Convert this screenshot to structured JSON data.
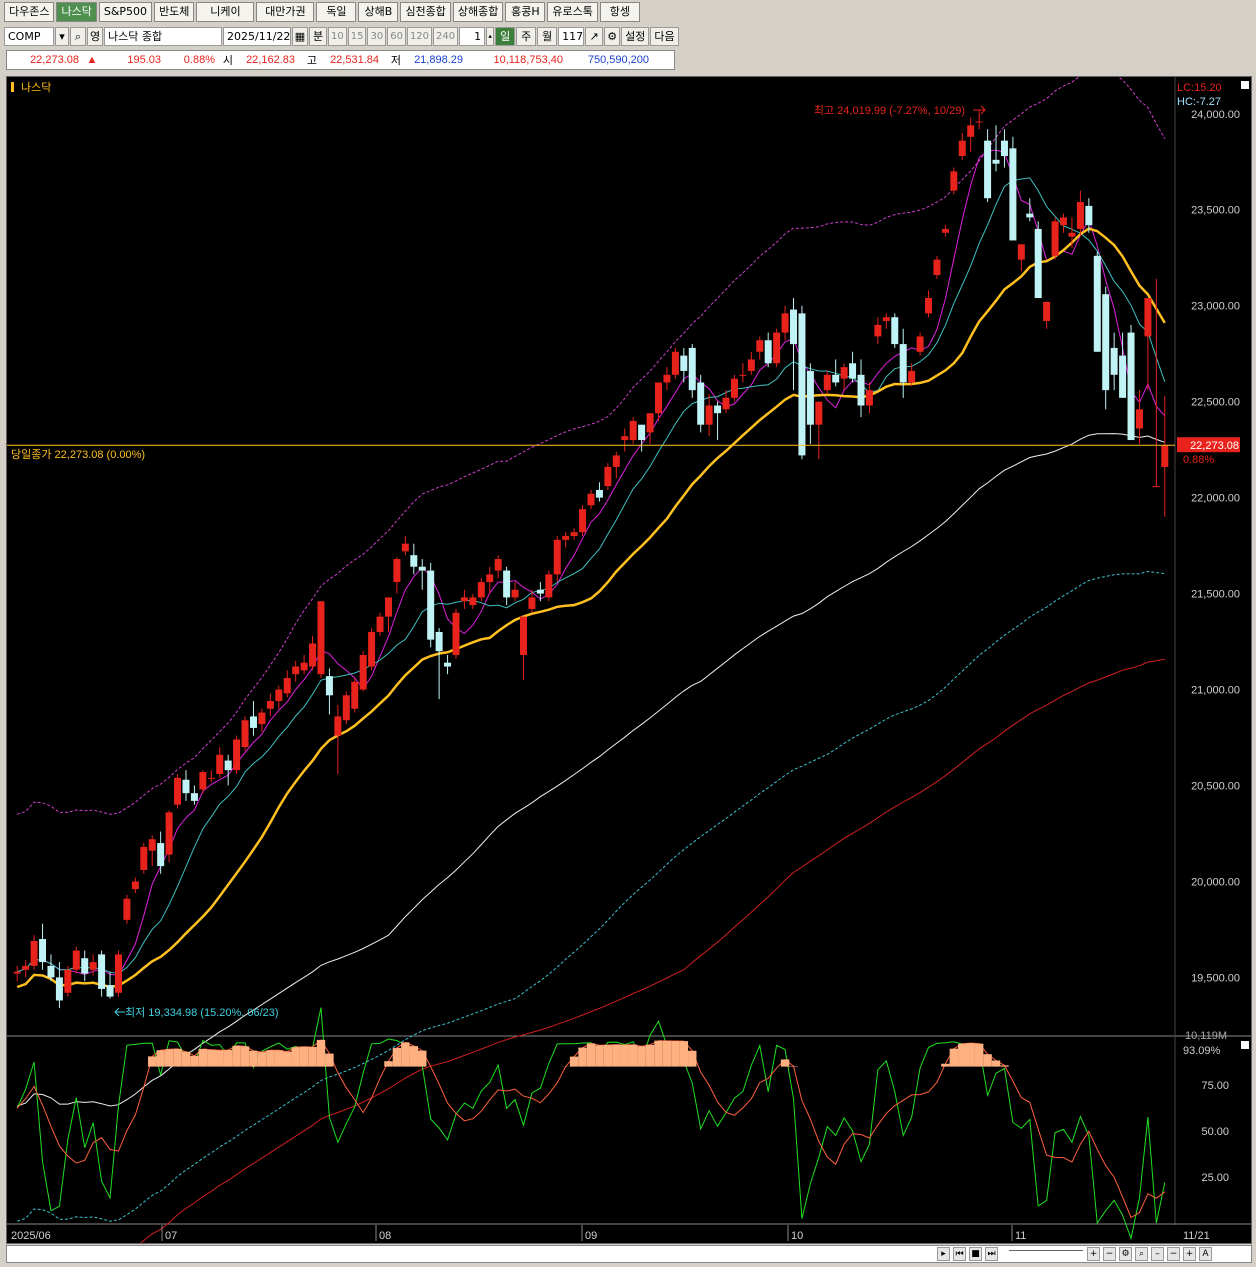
{
  "tabs": [
    "다우존스",
    "나스닥",
    "S&P500",
    "반도체",
    "니케이",
    "대만가권",
    "독일",
    "상해B",
    "심천종합",
    "상해종합",
    "홍콩H",
    "유로스톡",
    "항셍"
  ],
  "active_tab": 1,
  "toolbar": {
    "code": "COMP",
    "name": "나스닥 종합",
    "date": "2025/11/22",
    "periods": [
      "분",
      "10",
      "15",
      "30",
      "60",
      "120",
      "240"
    ],
    "count": "1",
    "day": "일",
    "week": "주",
    "month": "월",
    "bars": "117",
    "settings": "설정",
    "next": "다음"
  },
  "quote": {
    "price": "22,273.08",
    "arrow": "▲",
    "change": "195.03",
    "pct": "0.88%",
    "open_label": "시",
    "open": "22,162.83",
    "high_label": "고",
    "high": "22,531.84",
    "low_label": "저",
    "low": "21,898.29",
    "volume": "10,118,753,40",
    "amount": "750,590,200"
  },
  "chart_labels": {
    "series_name": "나스닥",
    "close_line": "당일종가 22,273.08 (0.00%)",
    "high_annot": "최고 24,019.99 (-7.27%, 10/29)",
    "low_annot": "최저 19,334.98 (15.20%, 06/23)",
    "lc": "LC:15.20",
    "hc": "HC:-7.27",
    "last_price": "22,273.08",
    "last_pct": "0.88%",
    "vol_mark": "10,119M",
    "osc_value": "93.09%"
  },
  "colors": {
    "up": "#e8231c",
    "down": "#bff3f5",
    "ma5": "#e020e0",
    "ma10": "#40c0c0",
    "ma20": "#ffc020",
    "ma60": "#f0f0f0",
    "ma120": "#d02020",
    "envelope": "#d040d0",
    "osc_k": "#20e020",
    "osc_d": "#ff6040"
  },
  "chart_data": {
    "type": "candlestick",
    "x_labels": [
      "2025/06",
      "07",
      "08",
      "09",
      "10",
      "11",
      "11/21"
    ],
    "y_ticks": [
      "24,000.00",
      "23,500.00",
      "23,000.00",
      "22,500.00",
      "22,000.00",
      "21,500.00",
      "21,000.00",
      "20,500.00",
      "20,000.00",
      "19,500.00"
    ],
    "ylim": [
      19200,
      24150
    ],
    "osc_ticks": [
      "75.00",
      "50.00",
      "25.00"
    ],
    "osc_ylim": [
      0,
      100
    ],
    "candles": [
      [
        19520,
        19560,
        19480,
        19530
      ],
      [
        19540,
        19590,
        19500,
        19560
      ],
      [
        19560,
        19720,
        19540,
        19690
      ],
      [
        19700,
        19780,
        19540,
        19580
      ],
      [
        19560,
        19620,
        19480,
        19500
      ],
      [
        19500,
        19580,
        19340,
        19380
      ],
      [
        19420,
        19560,
        19400,
        19540
      ],
      [
        19540,
        19660,
        19520,
        19640
      ],
      [
        19600,
        19640,
        19480,
        19520
      ],
      [
        19540,
        19620,
        19510,
        19580
      ],
      [
        19620,
        19640,
        19400,
        19440
      ],
      [
        19460,
        19530,
        19390,
        19400
      ],
      [
        19420,
        19640,
        19400,
        19620
      ],
      [
        19800,
        19930,
        19780,
        19910
      ],
      [
        19960,
        20020,
        19940,
        20000
      ],
      [
        20060,
        20200,
        20040,
        20180
      ],
      [
        20160,
        20240,
        20080,
        20220
      ],
      [
        20200,
        20260,
        20040,
        20080
      ],
      [
        20140,
        20370,
        20100,
        20360
      ],
      [
        20400,
        20560,
        20380,
        20540
      ],
      [
        20530,
        20580,
        20420,
        20460
      ],
      [
        20460,
        20500,
        20400,
        20420
      ],
      [
        20480,
        20580,
        20460,
        20570
      ],
      [
        20540,
        20580,
        20520,
        20540
      ],
      [
        20560,
        20700,
        20540,
        20660
      ],
      [
        20630,
        20660,
        20500,
        20580
      ],
      [
        20580,
        20760,
        20560,
        20740
      ],
      [
        20700,
        20860,
        20680,
        20840
      ],
      [
        20860,
        20940,
        20760,
        20800
      ],
      [
        20820,
        20900,
        20780,
        20880
      ],
      [
        20900,
        20980,
        20860,
        20940
      ],
      [
        20940,
        21020,
        20900,
        21000
      ],
      [
        20980,
        21100,
        20960,
        21060
      ],
      [
        21080,
        21150,
        21040,
        21120
      ],
      [
        21100,
        21180,
        21080,
        21140
      ],
      [
        21120,
        21280,
        21100,
        21240
      ],
      [
        21080,
        21320,
        21060,
        21460
      ],
      [
        21070,
        21110,
        20870,
        20970
      ],
      [
        20760,
        20920,
        20560,
        20860
      ],
      [
        20840,
        20990,
        20820,
        20970
      ],
      [
        20900,
        21060,
        20880,
        21040
      ],
      [
        21000,
        21200,
        20990,
        21180
      ],
      [
        21120,
        21320,
        21100,
        21300
      ],
      [
        21300,
        21400,
        21280,
        21380
      ],
      [
        21380,
        21480,
        21300,
        21480
      ],
      [
        21560,
        21690,
        21500,
        21680
      ],
      [
        21720,
        21800,
        21700,
        21760
      ],
      [
        21700,
        21760,
        21600,
        21640
      ],
      [
        21640,
        21680,
        21520,
        21620
      ],
      [
        21620,
        21660,
        21220,
        21260
      ],
      [
        21300,
        21320,
        20950,
        21200
      ],
      [
        21140,
        21180,
        21080,
        21120
      ],
      [
        21180,
        21420,
        21160,
        21400
      ],
      [
        21460,
        21520,
        21420,
        21480
      ],
      [
        21440,
        21500,
        21420,
        21480
      ],
      [
        21480,
        21580,
        21460,
        21560
      ],
      [
        21560,
        21640,
        21500,
        21600
      ],
      [
        21620,
        21700,
        21580,
        21680
      ],
      [
        21620,
        21640,
        21440,
        21480
      ],
      [
        21480,
        21560,
        21460,
        21520
      ],
      [
        21180,
        21380,
        21050,
        21380
      ],
      [
        21420,
        21520,
        21400,
        21480
      ],
      [
        21520,
        21560,
        21460,
        21500
      ],
      [
        21480,
        21620,
        21460,
        21600
      ],
      [
        21600,
        21800,
        21560,
        21780
      ],
      [
        21780,
        21820,
        21740,
        21800
      ],
      [
        21800,
        21840,
        21780,
        21820
      ],
      [
        21820,
        21960,
        21800,
        21940
      ],
      [
        21960,
        22040,
        21940,
        22020
      ],
      [
        22040,
        22080,
        21980,
        22000
      ],
      [
        22060,
        22180,
        22040,
        22160
      ],
      [
        22160,
        22240,
        22100,
        22220
      ],
      [
        22300,
        22360,
        22240,
        22320
      ],
      [
        22300,
        22420,
        22280,
        22400
      ],
      [
        22380,
        22360,
        22240,
        22300
      ],
      [
        22340,
        22420,
        22280,
        22440
      ],
      [
        22440,
        22500,
        22400,
        22600
      ],
      [
        22600,
        22680,
        22560,
        22640
      ],
      [
        22640,
        22780,
        22620,
        22760
      ],
      [
        22740,
        22780,
        22600,
        22660
      ],
      [
        22780,
        22800,
        22520,
        22560
      ],
      [
        22600,
        22640,
        22340,
        22380
      ],
      [
        22380,
        22540,
        22320,
        22480
      ],
      [
        22480,
        22500,
        22300,
        22440
      ],
      [
        22460,
        22560,
        22440,
        22520
      ],
      [
        22520,
        22640,
        22500,
        22620
      ],
      [
        22640,
        22700,
        22600,
        22640
      ],
      [
        22660,
        22760,
        22640,
        22720
      ],
      [
        22760,
        22840,
        22720,
        22820
      ],
      [
        22820,
        22860,
        22680,
        22700
      ],
      [
        22700,
        22880,
        22680,
        22860
      ],
      [
        22860,
        23000,
        22820,
        22960
      ],
      [
        22980,
        23040,
        22560,
        22800
      ],
      [
        22960,
        23000,
        22200,
        22220
      ],
      [
        22660,
        22700,
        22280,
        22380
      ],
      [
        22380,
        22500,
        22200,
        22500
      ],
      [
        22560,
        22660,
        22540,
        22640
      ],
      [
        22640,
        22720,
        22580,
        22600
      ],
      [
        22620,
        22700,
        22560,
        22680
      ],
      [
        22700,
        22760,
        22600,
        22620
      ],
      [
        22640,
        22720,
        22420,
        22480
      ],
      [
        22480,
        22600,
        22440,
        22560
      ],
      [
        22840,
        22940,
        22800,
        22900
      ],
      [
        22920,
        22960,
        22880,
        22940
      ],
      [
        22940,
        22960,
        22780,
        22800
      ],
      [
        22800,
        22880,
        22520,
        22600
      ],
      [
        22600,
        22700,
        22580,
        22660
      ],
      [
        22760,
        22860,
        22740,
        22840
      ],
      [
        22960,
        23080,
        22940,
        23040
      ],
      [
        23160,
        23260,
        23140,
        23240
      ],
      [
        23380,
        23420,
        23360,
        23400
      ],
      [
        23600,
        23720,
        23580,
        23700
      ],
      [
        23780,
        23900,
        23760,
        23860
      ],
      [
        23880,
        23980,
        23800,
        23940
      ],
      [
        23960,
        24020,
        23920,
        23960
      ],
      [
        23860,
        23920,
        23540,
        23560
      ],
      [
        23760,
        23940,
        23700,
        23740
      ],
      [
        23860,
        23920,
        23720,
        23780
      ],
      [
        23820,
        23880,
        23360,
        23340
      ],
      [
        23240,
        23320,
        23180,
        23320
      ],
      [
        23480,
        23560,
        23440,
        23460
      ],
      [
        23400,
        23440,
        23160,
        23040
      ],
      [
        22920,
        23020,
        22880,
        23020
      ],
      [
        23260,
        23460,
        23240,
        23440
      ],
      [
        23420,
        23480,
        23380,
        23460
      ],
      [
        23360,
        23460,
        23300,
        23380
      ],
      [
        23400,
        23600,
        23360,
        23540
      ],
      [
        23520,
        23560,
        23380,
        23420
      ],
      [
        23260,
        23280,
        22760,
        22760
      ],
      [
        23060,
        23100,
        22460,
        22560
      ],
      [
        22780,
        22860,
        22560,
        22640
      ],
      [
        22740,
        22860,
        22520,
        22520
      ],
      [
        22860,
        22900,
        22400,
        22300
      ],
      [
        22360,
        22560,
        22280,
        22460
      ],
      [
        22840,
        23000,
        22560,
        23040
      ],
      [
        22060,
        23140,
        22060,
        22060
      ],
      [
        22160,
        22530,
        21900,
        22273
      ]
    ],
    "ma20": [
      19200,
      19240,
      19280,
      19320,
      19360,
      19420,
      19480,
      19540,
      19610,
      19690,
      19780,
      19870,
      19960,
      20050,
      20150,
      20240,
      20330,
      20410,
      20480,
      20550,
      20620,
      20690,
      20760,
      20830,
      20900,
      20970,
      21040,
      21110,
      21160,
      21200,
      21240,
      21270,
      21300,
      21340,
      21380,
      21410,
      21460,
      21500,
      21540,
      21580,
      21610,
      21640,
      21680,
      21720,
      21760,
      21800,
      21840,
      21880,
      21930,
      21970,
      22020,
      22060,
      22100,
      22140,
      22180,
      22220,
      22260,
      22300,
      22340,
      22360,
      22380,
      22400,
      22420,
      22440,
      22460,
      22480,
      22500,
      22520,
      22540,
      22560,
      22580,
      22600,
      22620,
      22640,
      22670,
      22700,
      22730,
      22760,
      22790,
      22830,
      22880,
      22940,
      23000,
      23080,
      23140,
      23200,
      23240,
      23260,
      23270,
      23280,
      23270,
      23240,
      23180,
      23100,
      23020,
      22960,
      22900
    ]
  }
}
